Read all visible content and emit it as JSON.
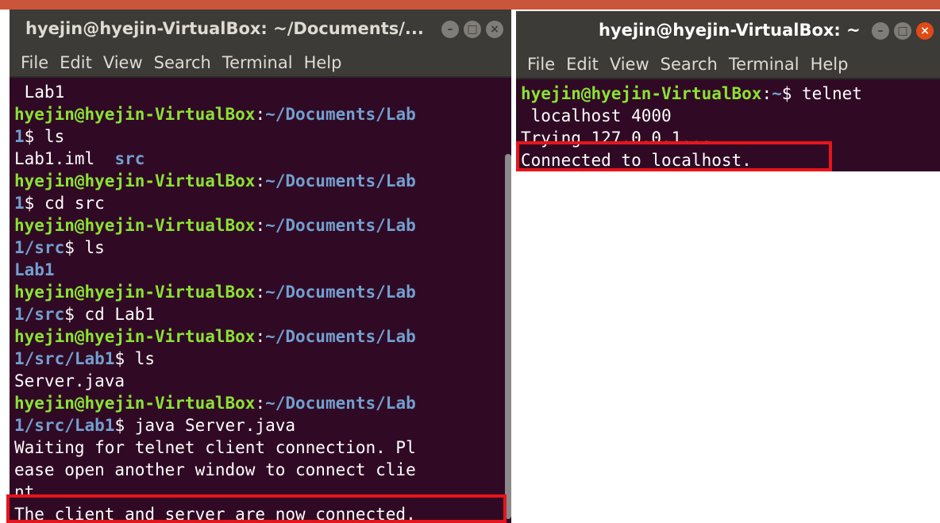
{
  "left_window": {
    "title": "hyejin@hyejin-VirtualBox: ~/Documents/...",
    "menu": [
      "File",
      "Edit",
      "View",
      "Search",
      "Terminal",
      "Help"
    ],
    "lines": [
      {
        "type": "output",
        "text": " Lab1"
      },
      {
        "type": "prompt",
        "user": "hyejin@hyejin-VirtualBox",
        "path": "~/Documents/Lab"
      },
      {
        "type": "prompt-cont",
        "path": "1",
        "cmd": "$ ls"
      },
      {
        "type": "mixed",
        "text": "Lab1.iml  ",
        "dir": "src"
      },
      {
        "type": "prompt",
        "user": "hyejin@hyejin-VirtualBox",
        "path": "~/Documents/Lab"
      },
      {
        "type": "prompt-cont",
        "path": "1",
        "cmd": "$ cd src"
      },
      {
        "type": "prompt",
        "user": "hyejin@hyejin-VirtualBox",
        "path": "~/Documents/Lab"
      },
      {
        "type": "prompt-cont",
        "path": "1/src",
        "cmd": "$ ls"
      },
      {
        "type": "dir",
        "text": "Lab1"
      },
      {
        "type": "prompt",
        "user": "hyejin@hyejin-VirtualBox",
        "path": "~/Documents/Lab"
      },
      {
        "type": "prompt-cont",
        "path": "1/src",
        "cmd": "$ cd Lab1"
      },
      {
        "type": "prompt",
        "user": "hyejin@hyejin-VirtualBox",
        "path": "~/Documents/Lab"
      },
      {
        "type": "prompt-cont",
        "path": "1/src/Lab1",
        "cmd": "$ ls"
      },
      {
        "type": "output",
        "text": "Server.java"
      },
      {
        "type": "prompt",
        "user": "hyejin@hyejin-VirtualBox",
        "path": "~/Documents/Lab"
      },
      {
        "type": "prompt-cont",
        "path": "1/src/Lab1",
        "cmd": "$ java Server.java"
      },
      {
        "type": "output",
        "text": "Waiting for telnet client connection. Pl"
      },
      {
        "type": "output",
        "text": "ease open another window to connect clie"
      },
      {
        "type": "output",
        "text": "nt."
      },
      {
        "type": "output",
        "text": "The client and server are now connected."
      }
    ]
  },
  "right_window": {
    "title": "hyejin@hyejin-VirtualBox: ~",
    "menu": [
      "File",
      "Edit",
      "View",
      "Search",
      "Terminal",
      "Help"
    ],
    "lines": [
      {
        "type": "prompt-full",
        "user": "hyejin@hyejin-VirtualBox",
        "path": "~",
        "cmd": "$ telnet"
      },
      {
        "type": "output",
        "text": " localhost 4000"
      },
      {
        "type": "output",
        "text": "Trying 127.0.0.1..."
      },
      {
        "type": "output",
        "text": "Connected to localhost."
      }
    ]
  },
  "colors": {
    "terminal_bg": "#300a24",
    "prompt_user": "#8ae234",
    "prompt_path": "#729fcf",
    "highlight": "#e8141c"
  }
}
